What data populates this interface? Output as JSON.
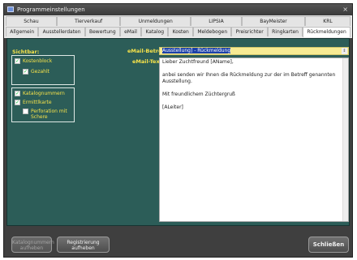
{
  "window": {
    "title": "Programmeinstellungen",
    "close": "×"
  },
  "tabs_row1": [
    "Schau",
    "Tierverkauf",
    "Unmeldungen",
    "LIPSIA",
    "BayMeister",
    "KRL"
  ],
  "tabs_row2": [
    "Allgemein",
    "Ausstellerdaten",
    "Bewertung",
    "eMail",
    "Katalog",
    "Kosten",
    "Meldebogen",
    "Preisrichter",
    "Ringkarten",
    "Rückmeldungen"
  ],
  "active_tab": "Rückmeldungen",
  "panel": {
    "visible_label": "Sichtbar:",
    "groups": [
      {
        "items": [
          {
            "label": "Kostenblock",
            "checked": true
          },
          {
            "label": "Gezahlt",
            "checked": true
          }
        ]
      },
      {
        "items": [
          {
            "label": "Katalognummern",
            "checked": true
          },
          {
            "label": "Ermittlkarte",
            "checked": true
          },
          {
            "label": "Perforation mit Schere",
            "checked": false
          }
        ]
      }
    ],
    "subject_label": "eMail-Betreff:",
    "subject_value": "Ausstellung] - Rückmeldung",
    "text_label": "eMail-Text:",
    "text_lines": [
      "Lieber Zuchtfreund [AName],",
      "",
      "anbei senden wir Ihnen die Rückmeldung zur der im Betreff genannten Ausstellung.",
      "",
      "Mit freundlichem Züchtergruß",
      "",
      "[ALeiter]"
    ]
  },
  "buttons": {
    "catalog_numbers": "Katalognummern aufheben",
    "registration": "Registrierung aufheben",
    "close": "Schließen"
  }
}
